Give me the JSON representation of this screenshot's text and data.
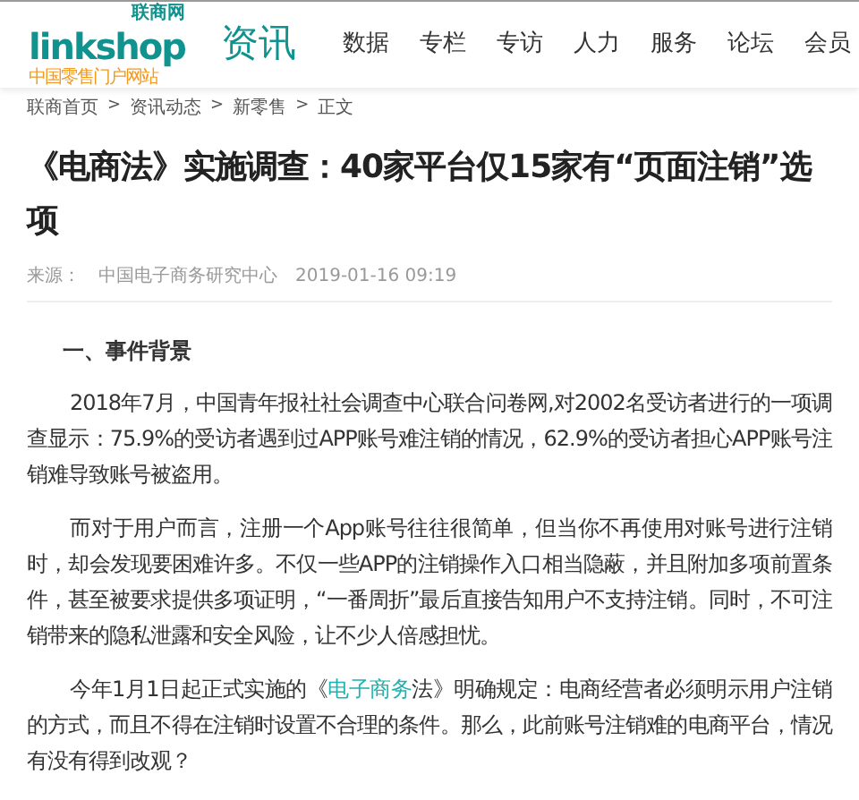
{
  "header": {
    "logo": {
      "wordmark": "linkshop",
      "badge": "联商网",
      "tagline": "中国零售门户网站"
    },
    "section_title": "资讯",
    "nav": [
      "数据",
      "专栏",
      "专访",
      "人力",
      "服务",
      "论坛",
      "会员"
    ]
  },
  "breadcrumb": [
    "联商首页",
    "资讯动态",
    "新零售",
    "正文"
  ],
  "breadcrumb_separator": ">",
  "article": {
    "title": "《电商法》实施调查：40家平台仅15家有“页面注销”选项",
    "source_label": "来源：",
    "source": "中国电子商务研究中心",
    "date": "2019-01-16 09:19",
    "heading": "一、事件背景",
    "paragraphs": [
      {
        "before": "2018年7月，中国青年报社社会调查中心联合问卷网,对2002名受访者进行的一项调查显示：75.9%的受访者遇到过APP账号难注销的情况，62.9%的受访者担心APP账号注销难导致账号被盗用。"
      },
      {
        "before": "而对于用户而言，注册一个App账号往往很简单，但当你不再使用对账号进行注销时，却会发现要困难许多。不仅一些APP的注销操作入口相当隐蔽，并且附加多项前置条件，甚至被要求提供多项证明，“一番周折”最后直接告知用户不支持注销。同时，不可注销带来的隐私泄露和安全风险，让不少人倍感担忧。"
      },
      {
        "before": "今年1月1日起正式实施的《",
        "link": "电子商务",
        "after": "法》明确规定：电商经营者必须明示用户注销的方式，而且不得在注销时设置不合理的条件。那么，此前账号注销难的电商平台，情况有没有得到改观？"
      }
    ]
  }
}
